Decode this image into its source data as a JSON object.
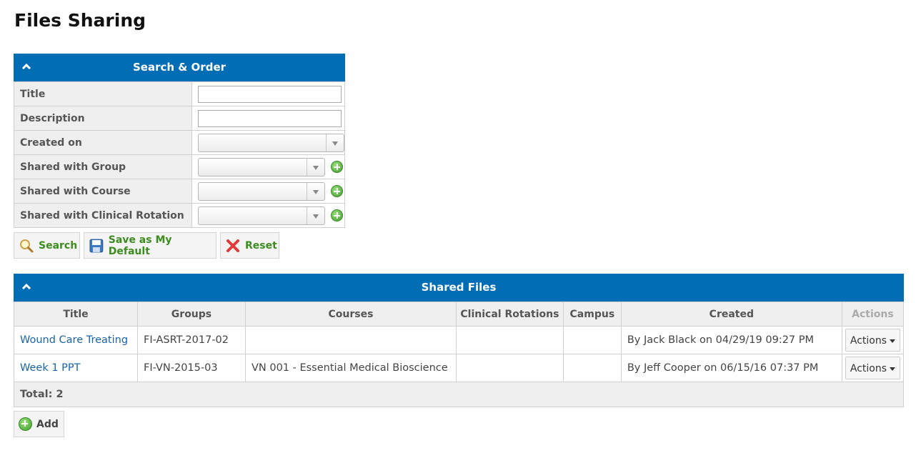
{
  "page": {
    "title": "Files Sharing"
  },
  "search_panel": {
    "title": "Search & Order",
    "fields": [
      {
        "label": "Title",
        "type": "text",
        "value": ""
      },
      {
        "label": "Description",
        "type": "text",
        "value": ""
      },
      {
        "label": "Created on",
        "type": "select",
        "value": ""
      },
      {
        "label": "Shared with Group",
        "type": "select",
        "value": ""
      },
      {
        "label": "Shared with Course",
        "type": "select",
        "value": ""
      },
      {
        "label": "Shared with Clinical Rotation",
        "type": "select",
        "value": ""
      }
    ],
    "buttons": {
      "search": "Search",
      "save_default": "Save as My Default",
      "reset": "Reset"
    }
  },
  "files_panel": {
    "title": "Shared Files",
    "columns": [
      "Title",
      "Groups",
      "Courses",
      "Clinical Rotations",
      "Campus",
      "Created",
      "Actions"
    ],
    "rows": [
      {
        "title": "Wound Care Treating",
        "groups": "FI-ASRT-2017-02",
        "courses": "",
        "clinical_rotations": "",
        "campus": "",
        "created": "By Jack Black on 04/29/19 09:27 PM",
        "actions": "Actions"
      },
      {
        "title": "Week 1 PPT",
        "groups": "FI-VN-2015-03",
        "courses": "VN 001 - Essential Medical Bioscience",
        "clinical_rotations": "",
        "campus": "",
        "created": "By Jeff Cooper on 06/15/16 07:37 PM",
        "actions": "Actions"
      }
    ],
    "total": "Total: 2",
    "add_label": "Add"
  },
  "colors": {
    "header_blue": "#006db5",
    "link_blue": "#1a64a8",
    "button_green": "#3c8d1f"
  },
  "icons": {
    "collapse": "chevron-up-icon",
    "search": "magnifier-icon",
    "save": "floppy-disk-icon",
    "reset": "red-x-icon",
    "add": "green-plus-icon"
  }
}
